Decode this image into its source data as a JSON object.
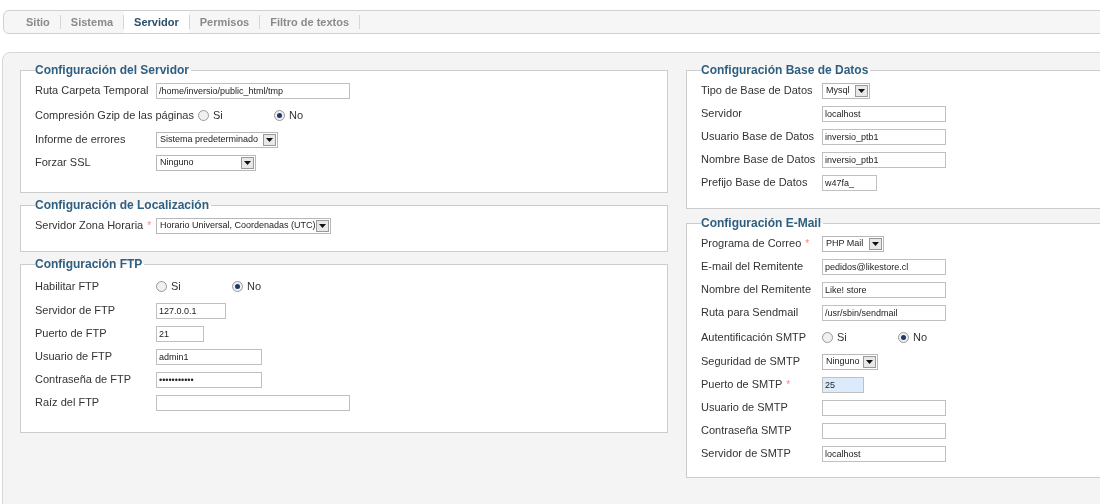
{
  "tabs": [
    {
      "label": "Sitio",
      "selected": false
    },
    {
      "label": "Sistema",
      "selected": false
    },
    {
      "label": "Servidor",
      "selected": true
    },
    {
      "label": "Permisos",
      "selected": false
    },
    {
      "label": "Filtro de textos",
      "selected": false
    }
  ],
  "left_sections": [
    {
      "title": "Configuración del Servidor",
      "fields": [
        {
          "kind": "text",
          "label": "Ruta Carpeta Temporal",
          "value": "/home/inversio/public_html/tmp"
        },
        {
          "kind": "radio",
          "label": "Compresión Gzip de las páginas",
          "options": [
            {
              "label": "Si",
              "selected": false
            },
            {
              "label": "No",
              "selected": true
            }
          ]
        },
        {
          "kind": "select",
          "label": "Informe de errores",
          "value": "Sistema predeterminado"
        },
        {
          "kind": "select",
          "label": "Forzar SSL",
          "value": "Ninguno"
        }
      ]
    },
    {
      "title": "Configuración de Localización",
      "fields": [
        {
          "kind": "select",
          "label": "Servidor Zona Horaria",
          "required_mark": "*",
          "value": "Horario Universal, Coordenadas (UTC)"
        }
      ]
    },
    {
      "title": "Configuración FTP",
      "fields": [
        {
          "kind": "radio",
          "label": "Habilitar FTP",
          "options": [
            {
              "label": "Si",
              "selected": false
            },
            {
              "label": "No",
              "selected": true
            }
          ]
        },
        {
          "kind": "text",
          "label": "Servidor de FTP",
          "value": "127.0.0.1"
        },
        {
          "kind": "text",
          "label": "Puerto de FTP",
          "value": "21"
        },
        {
          "kind": "text",
          "label": "Usuario de FTP",
          "value": "admin1"
        },
        {
          "kind": "text",
          "label": "Contraseña de FTP",
          "value": "•••••••••••"
        },
        {
          "kind": "text",
          "label": "Raíz del FTP"
        }
      ]
    }
  ],
  "right_sections": [
    {
      "title": "Configuración Base de Datos",
      "fields": [
        {
          "kind": "select",
          "label": "Tipo de Base de Datos",
          "value": "Mysql"
        },
        {
          "kind": "text",
          "label": "Servidor",
          "value": "localhost"
        },
        {
          "kind": "text",
          "label": "Usuario Base de Datos",
          "value": "inversio_ptb1"
        },
        {
          "kind": "text",
          "label": "Nombre Base de Datos",
          "value": "inversio_ptb1"
        },
        {
          "kind": "text",
          "label": "Prefijo Base de Datos",
          "value": "w47fa_"
        }
      ]
    },
    {
      "title": "Configuración E-Mail",
      "fields": [
        {
          "kind": "select",
          "label": "Programa de Correo",
          "required_mark": "*",
          "value": "PHP Mail"
        },
        {
          "kind": "text",
          "label": "E-mail del Remitente",
          "value": "pedidos@likestore.cl"
        },
        {
          "kind": "text",
          "label": "Nombre del Remitente",
          "value": "Like! store"
        },
        {
          "kind": "text",
          "label": "Ruta para Sendmail",
          "value": "/usr/sbin/sendmail"
        },
        {
          "kind": "radio",
          "label": "Autentificación SMTP",
          "options": [
            {
              "label": "Si",
              "selected": false
            },
            {
              "label": "No",
              "selected": true
            }
          ]
        },
        {
          "kind": "select",
          "label": "Seguridad de SMTP",
          "value": "Ninguno"
        },
        {
          "kind": "text",
          "label": "Puerto de SMTP",
          "required_mark": "*",
          "value": "25",
          "highlighted": true
        },
        {
          "kind": "text",
          "label": "Usuario de SMTP"
        },
        {
          "kind": "text",
          "label": "Contraseña SMTP"
        },
        {
          "kind": "text",
          "label": "Servidor de SMTP",
          "value": "localhost"
        }
      ]
    }
  ]
}
